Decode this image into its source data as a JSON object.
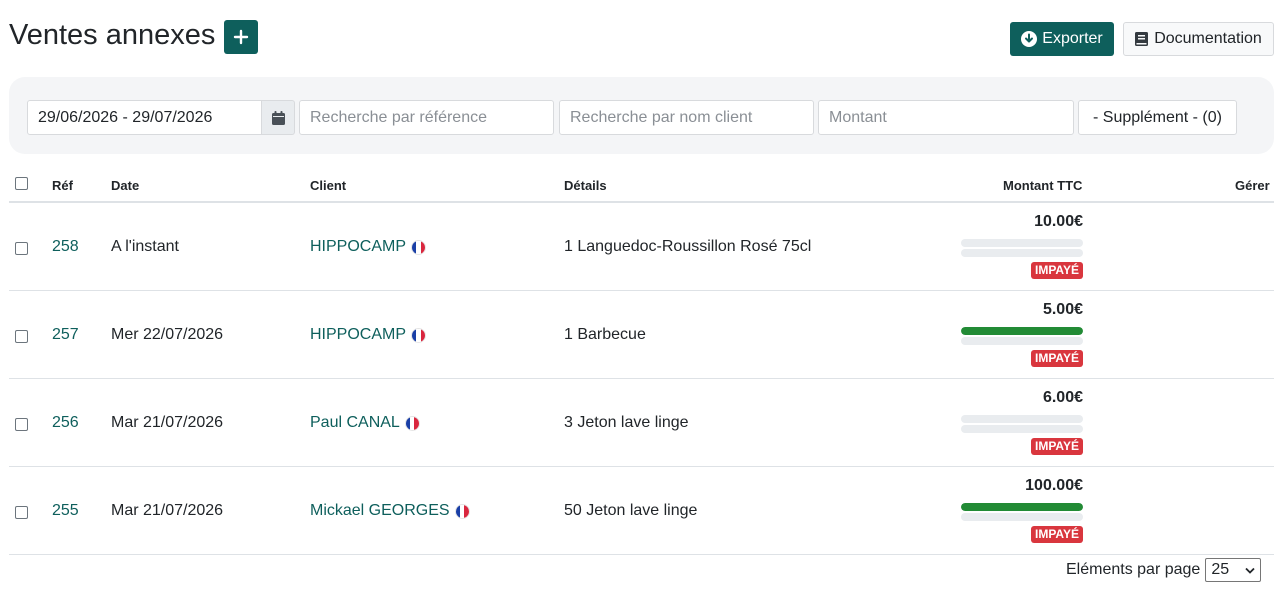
{
  "header": {
    "title": "Ventes annexes",
    "add_label": "+",
    "export_label": "Exporter",
    "documentation_label": "Documentation"
  },
  "filters": {
    "date_range": "29/06/2026 - 29/07/2026",
    "ref_placeholder": "Recherche par référence",
    "client_placeholder": "Recherche par nom client",
    "amount_placeholder": "Montant",
    "supplement_label": "- Supplément - (0)"
  },
  "table": {
    "columns": {
      "ref": "Réf",
      "date": "Date",
      "client": "Client",
      "details": "Détails",
      "amount": "Montant TTC",
      "manage": "Gérer"
    },
    "rows": [
      {
        "ref": "258",
        "date": "A l'instant",
        "client": "HIPPOCAMP",
        "details": "1 Languedoc-Roussillon Rosé 75cl",
        "amount": "10.00€",
        "paid_fraction": 0,
        "status": "IMPAYÉ"
      },
      {
        "ref": "257",
        "date": "Mer 22/07/2026",
        "client": "HIPPOCAMP",
        "details": "1 Barbecue",
        "amount": "5.00€",
        "paid_fraction": 1,
        "status": "IMPAYÉ"
      },
      {
        "ref": "256",
        "date": "Mar 21/07/2026",
        "client": "Paul CANAL",
        "details": "3 Jeton lave linge",
        "amount": "6.00€",
        "paid_fraction": 0,
        "status": "IMPAYÉ"
      },
      {
        "ref": "255",
        "date": "Mar 21/07/2026",
        "client": "Mickael GEORGES",
        "details": "50 Jeton lave linge",
        "amount": "100.00€",
        "paid_fraction": 1,
        "status": "IMPAYÉ"
      }
    ]
  },
  "pagination": {
    "per_page_label": "Eléments par page",
    "per_page_value": "25"
  },
  "colors": {
    "primary": "#0e5f5c",
    "paid_bar": "#228b35",
    "unpaid_badge": "#d9363e"
  }
}
